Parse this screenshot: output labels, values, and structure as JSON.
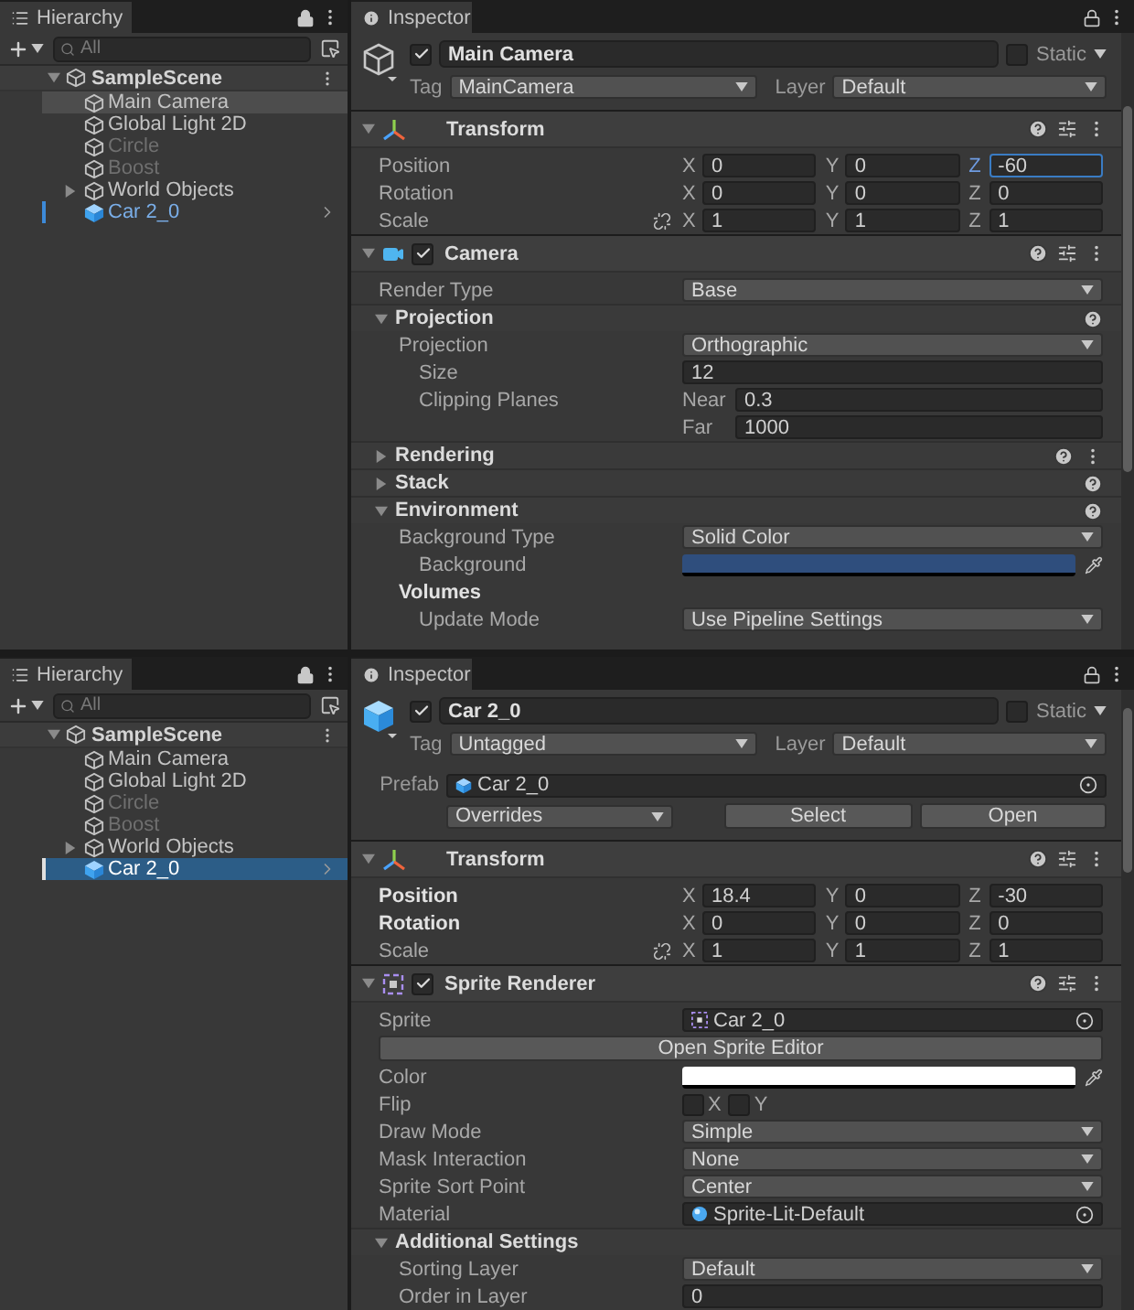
{
  "panels": [
    {
      "hierarchy": {
        "tab": "Hierarchy",
        "focused": false,
        "search": {
          "placeholder": "All"
        },
        "scene": {
          "name": "SampleScene",
          "expanded": true
        },
        "items": [
          {
            "label": "Main Camera",
            "selected": true,
            "disabled": false,
            "prefab": false
          },
          {
            "label": "Global Light 2D",
            "selected": false,
            "disabled": false,
            "prefab": false
          },
          {
            "label": "Circle",
            "selected": false,
            "disabled": true,
            "prefab": false
          },
          {
            "label": "Boost",
            "selected": false,
            "disabled": true,
            "prefab": false
          },
          {
            "label": "World Objects",
            "selected": false,
            "disabled": false,
            "prefab": false,
            "expanded": false
          },
          {
            "label": "Car 2_0",
            "selected": false,
            "disabled": false,
            "prefab": true
          }
        ]
      },
      "inspector": {
        "tab": "Inspector",
        "object": {
          "kind": "gameobject",
          "active": true,
          "name": "Main Camera",
          "static_label": "Static",
          "static": false,
          "tag_label": "Tag",
          "tag": "MainCamera",
          "layer_label": "Layer",
          "layer": "Default"
        },
        "components": [
          {
            "kind": "transform",
            "title": "Transform",
            "expanded": true,
            "rows": [
              {
                "kind": "vector3",
                "label": "Position",
                "overridden": false,
                "link": false,
                "fields": [
                  {
                    "axis": "X",
                    "value": "0",
                    "focused": false
                  },
                  {
                    "axis": "Y",
                    "value": "0",
                    "focused": false
                  },
                  {
                    "axis": "Z",
                    "value": "-60",
                    "focused": true
                  }
                ]
              },
              {
                "kind": "vector3",
                "label": "Rotation",
                "overridden": false,
                "link": false,
                "fields": [
                  {
                    "axis": "X",
                    "value": "0",
                    "focused": false
                  },
                  {
                    "axis": "Y",
                    "value": "0",
                    "focused": false
                  },
                  {
                    "axis": "Z",
                    "value": "0",
                    "focused": false
                  }
                ]
              },
              {
                "kind": "vector3",
                "label": "Scale",
                "overridden": false,
                "link": true,
                "fields": [
                  {
                    "axis": "X",
                    "value": "1",
                    "focused": false
                  },
                  {
                    "axis": "Y",
                    "value": "1",
                    "focused": false
                  },
                  {
                    "axis": "Z",
                    "value": "1",
                    "focused": false
                  }
                ]
              }
            ]
          },
          {
            "kind": "camera",
            "title": "Camera",
            "enabled": true,
            "expanded": true,
            "rows": [
              {
                "kind": "dropdown",
                "label": "Render Type",
                "value": "Base"
              },
              {
                "kind": "foldout",
                "title": "Projection",
                "expanded": true,
                "menu": false,
                "children": [
                  {
                    "kind": "dropdown",
                    "label": "Projection",
                    "value": "Orthographic",
                    "children": [
                      {
                        "kind": "number",
                        "label": "Size",
                        "value": "12"
                      },
                      {
                        "kind": "planes",
                        "label": "Clipping Planes",
                        "fields": [
                          {
                            "prefix": "Near",
                            "value": "0.3"
                          },
                          {
                            "prefix": "Far",
                            "value": "1000"
                          }
                        ]
                      }
                    ]
                  }
                ]
              },
              {
                "kind": "foldout",
                "title": "Rendering",
                "expanded": false,
                "menu": true
              },
              {
                "kind": "foldout",
                "title": "Stack",
                "expanded": false,
                "menu": false
              },
              {
                "kind": "foldout",
                "title": "Environment",
                "expanded": true,
                "menu": false,
                "children": [
                  {
                    "kind": "dropdown",
                    "label": "Background Type",
                    "value": "Solid Color",
                    "children": [
                      {
                        "kind": "color",
                        "label": "Background",
                        "color": "#2f4e7d"
                      }
                    ]
                  },
                  {
                    "kind": "heading",
                    "label": "Volumes",
                    "children": [
                      {
                        "kind": "dropdown",
                        "label": "Update Mode",
                        "value": "Use Pipeline Settings"
                      }
                    ]
                  }
                ]
              }
            ]
          }
        ]
      }
    },
    {
      "hierarchy": {
        "tab": "Hierarchy",
        "focused": true,
        "search": {
          "placeholder": "All"
        },
        "scene": {
          "name": "SampleScene",
          "expanded": true
        },
        "items": [
          {
            "label": "Main Camera",
            "selected": false,
            "disabled": false,
            "prefab": false
          },
          {
            "label": "Global Light 2D",
            "selected": false,
            "disabled": false,
            "prefab": false
          },
          {
            "label": "Circle",
            "selected": false,
            "disabled": true,
            "prefab": false
          },
          {
            "label": "Boost",
            "selected": false,
            "disabled": true,
            "prefab": false
          },
          {
            "label": "World Objects",
            "selected": false,
            "disabled": false,
            "prefab": false,
            "expanded": false
          },
          {
            "label": "Car 2_0",
            "selected": true,
            "disabled": false,
            "prefab": true
          }
        ]
      },
      "inspector": {
        "tab": "Inspector",
        "object": {
          "kind": "prefab",
          "active": true,
          "name": "Car 2_0",
          "static_label": "Static",
          "static": false,
          "tag_label": "Tag",
          "tag": "Untagged",
          "layer_label": "Layer",
          "layer": "Default",
          "prefab": {
            "label": "Prefab",
            "asset": "Car 2_0",
            "overrides": "Overrides",
            "select": "Select",
            "open": "Open"
          }
        },
        "components": [
          {
            "kind": "transform",
            "title": "Transform",
            "expanded": true,
            "rows": [
              {
                "kind": "vector3",
                "label": "Position",
                "overridden": true,
                "link": false,
                "fields": [
                  {
                    "axis": "X",
                    "value": "18.4",
                    "focused": false
                  },
                  {
                    "axis": "Y",
                    "value": "0",
                    "focused": false
                  },
                  {
                    "axis": "Z",
                    "value": "-30",
                    "focused": false
                  }
                ]
              },
              {
                "kind": "vector3",
                "label": "Rotation",
                "overridden": true,
                "link": false,
                "fields": [
                  {
                    "axis": "X",
                    "value": "0",
                    "focused": false
                  },
                  {
                    "axis": "Y",
                    "value": "0",
                    "focused": false
                  },
                  {
                    "axis": "Z",
                    "value": "0",
                    "focused": false
                  }
                ]
              },
              {
                "kind": "vector3",
                "label": "Scale",
                "overridden": false,
                "link": true,
                "fields": [
                  {
                    "axis": "X",
                    "value": "1",
                    "focused": false
                  },
                  {
                    "axis": "Y",
                    "value": "1",
                    "focused": false
                  },
                  {
                    "axis": "Z",
                    "value": "1",
                    "focused": false
                  }
                ]
              }
            ]
          },
          {
            "kind": "sprite_renderer",
            "title": "Sprite Renderer",
            "enabled": true,
            "expanded": true,
            "rows": [
              {
                "kind": "sprite",
                "label": "Sprite",
                "value": "Car 2_0"
              },
              {
                "kind": "button",
                "label": "Open Sprite Editor"
              },
              {
                "kind": "color",
                "label": "Color",
                "color": "#ffffff"
              },
              {
                "kind": "flip",
                "label": "Flip",
                "toggles": [
                  {
                    "label": "X",
                    "checked": false
                  },
                  {
                    "label": "Y",
                    "checked": false
                  }
                ]
              },
              {
                "kind": "dropdown",
                "label": "Draw Mode",
                "value": "Simple"
              },
              {
                "kind": "dropdown",
                "label": "Mask Interaction",
                "value": "None"
              },
              {
                "kind": "dropdown",
                "label": "Sprite Sort Point",
                "value": "Center"
              },
              {
                "kind": "material",
                "label": "Material",
                "value": "Sprite-Lit-Default"
              },
              {
                "kind": "foldout",
                "title": "Additional Settings",
                "expanded": true,
                "help": false,
                "menu": false,
                "children": [
                  {
                    "kind": "dropdown",
                    "label": "Sorting Layer",
                    "value": "Default"
                  },
                  {
                    "kind": "number",
                    "label": "Order in Layer",
                    "value": "0"
                  }
                ]
              }
            ]
          }
        ]
      }
    }
  ]
}
